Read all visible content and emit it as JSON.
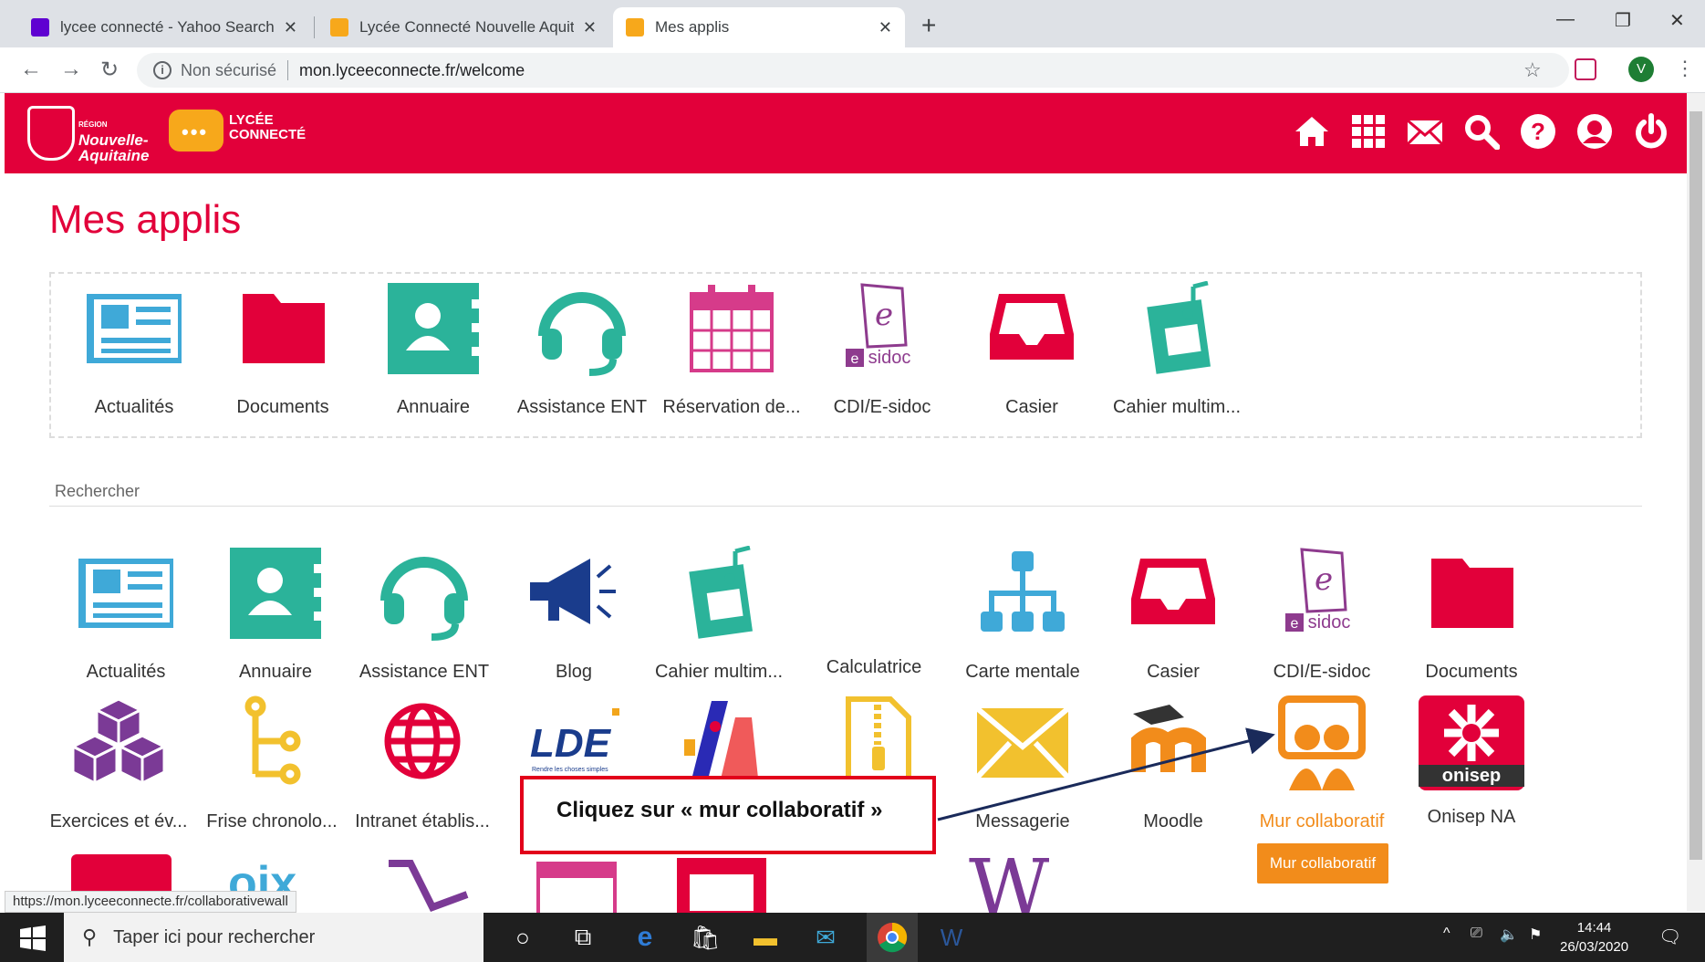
{
  "browser": {
    "tabs": [
      {
        "title": "lycee connecté - Yahoo Search - /",
        "favicon": "yahoo-icon",
        "color": "#5f01d1"
      },
      {
        "title": "Lycée Connecté Nouvelle Aquitai",
        "favicon": "lycee-connecte-icon",
        "color": "#f7a81b"
      },
      {
        "title": "Mes applis",
        "favicon": "lycee-connecte-icon",
        "color": "#f7a81b"
      }
    ],
    "new_tab": "+",
    "security": "Non sécurisé",
    "url": "mon.lyceeconnecte.fr/welcome",
    "profile_initial": "V"
  },
  "header": {
    "region_name": "Nouvelle-\nAquitaine",
    "region_small": "RÉGION",
    "lycee_logo": "LYCÉE\nCONNECTÉ",
    "brand_color": "#e2003a",
    "icons": [
      "home-icon",
      "apps-grid-icon",
      "mail-icon",
      "search-icon",
      "help-icon",
      "user-icon",
      "power-icon"
    ]
  },
  "page": {
    "title": "Mes applis",
    "search_label": "Rechercher"
  },
  "favorites": [
    {
      "label": "Actualités",
      "icon": "newspaper-icon"
    },
    {
      "label": "Documents",
      "icon": "folder-icon"
    },
    {
      "label": "Annuaire",
      "icon": "contact-book-icon"
    },
    {
      "label": "Assistance ENT",
      "icon": "headset-icon"
    },
    {
      "label": "Réservation de...",
      "icon": "calendar-icon"
    },
    {
      "label": "CDI/E-sidoc",
      "icon": "esidoc-icon"
    },
    {
      "label": "Casier",
      "icon": "inbox-tray-icon"
    },
    {
      "label": "Cahier multim...",
      "icon": "multimedia-notebook-icon"
    }
  ],
  "apps_row1": [
    {
      "label": "Actualités",
      "icon": "newspaper-icon"
    },
    {
      "label": "Annuaire",
      "icon": "contact-book-icon"
    },
    {
      "label": "Assistance ENT",
      "icon": "headset-icon"
    },
    {
      "label": "Blog",
      "icon": "megaphone-icon"
    },
    {
      "label": "Cahier multim...",
      "icon": "multimedia-notebook-icon"
    },
    {
      "label": "Calculatrice",
      "icon": "calculator-icon"
    },
    {
      "label": "Carte mentale",
      "icon": "mind-map-icon"
    },
    {
      "label": "Casier",
      "icon": "inbox-tray-icon"
    },
    {
      "label": "CDI/E-sidoc",
      "icon": "esidoc-icon"
    },
    {
      "label": "Documents",
      "icon": "folder-icon"
    }
  ],
  "apps_row2": [
    {
      "label": "Exercices et év...",
      "icon": "cubes-icon"
    },
    {
      "label": "Frise chronolo...",
      "icon": "timeline-icon"
    },
    {
      "label": "Intranet établis...",
      "icon": "globe-icon"
    },
    {
      "label": "",
      "icon": "lde-logo-icon",
      "logo_text": "LDE",
      "logo_sub": "Rendre les choses simples"
    },
    {
      "label": "",
      "icon": "app-logo-icon"
    },
    {
      "label": "",
      "icon": "zip-file-icon"
    },
    {
      "label": "Messagerie",
      "icon": "envelope-icon"
    },
    {
      "label": "Moodle",
      "icon": "moodle-icon"
    },
    {
      "label": "Mur collaboratif",
      "icon": "collaborative-wall-icon"
    },
    {
      "label": "Onisep NA",
      "icon": "onisep-icon",
      "logo_text": "onisep"
    }
  ],
  "tooltip": "Mur collaboratif",
  "callout": "Cliquez sur « mur collaboratif »",
  "status_url": "https://mon.lyceeconnecte.fr/collaborativewall",
  "taskbar": {
    "search_placeholder": "Taper ici pour rechercher",
    "time": "14:44",
    "date": "26/03/2020"
  }
}
